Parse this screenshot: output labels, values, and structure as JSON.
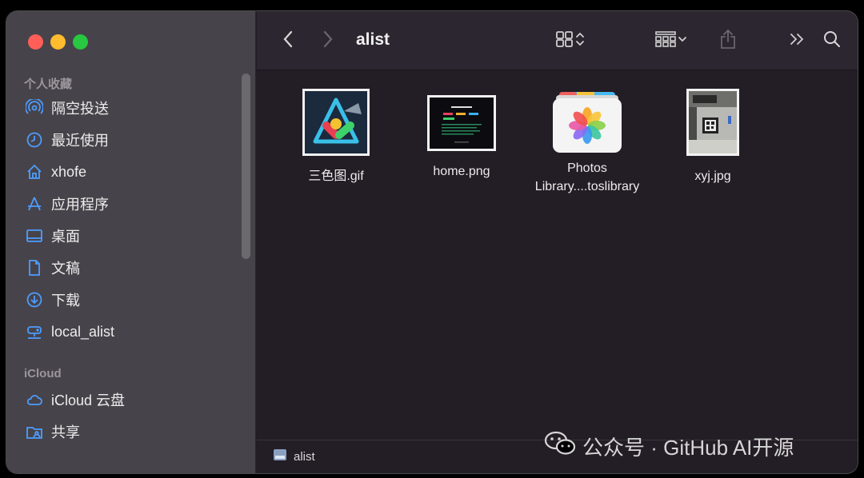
{
  "window": {
    "title": "alist"
  },
  "sidebar": {
    "sections": [
      {
        "title": "个人收藏",
        "items": [
          {
            "icon": "airdrop-icon",
            "label": "隔空投送"
          },
          {
            "icon": "clock-icon",
            "label": "最近使用"
          },
          {
            "icon": "home-icon",
            "label": "xhofe"
          },
          {
            "icon": "applications-icon",
            "label": "应用程序"
          },
          {
            "icon": "desktop-icon",
            "label": "桌面"
          },
          {
            "icon": "document-icon",
            "label": "文稿"
          },
          {
            "icon": "download-icon",
            "label": "下载"
          },
          {
            "icon": "network-drive-icon",
            "label": "local_alist"
          }
        ]
      },
      {
        "title": "iCloud",
        "items": [
          {
            "icon": "cloud-icon",
            "label": "iCloud 云盘"
          },
          {
            "icon": "shared-folder-icon",
            "label": "共享"
          }
        ]
      }
    ]
  },
  "files": [
    {
      "name": "三色图.gif",
      "type": "gif-image"
    },
    {
      "name": "home.png",
      "type": "png-image"
    },
    {
      "name": "Photos Library....toslibrary",
      "name_line1": "Photos",
      "name_line2": "Library....toslibrary",
      "type": "photos-library"
    },
    {
      "name": "xyj.jpg",
      "type": "jpg-image"
    }
  ],
  "pathbar": {
    "label": "alist"
  },
  "watermark": {
    "text": "公众号 · GitHub AI开源"
  },
  "colors": {
    "sidebar_bg": "#47434a",
    "content_bg": "#231d26",
    "accent": "#4c9dff"
  }
}
